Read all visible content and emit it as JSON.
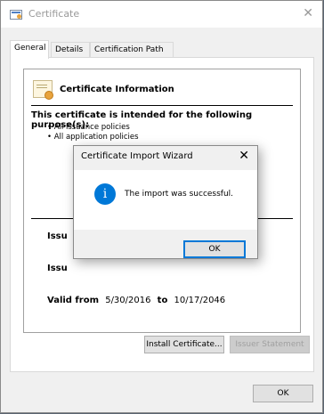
{
  "window": {
    "title": "Certificate",
    "close_glyph": "✕",
    "icon": "certificate-icon"
  },
  "tabs": [
    {
      "label": "General",
      "active": true
    },
    {
      "label": "Details",
      "active": false
    },
    {
      "label": "Certification Path",
      "active": false
    }
  ],
  "info": {
    "icon": "certificate-icon",
    "title": "Certificate Information",
    "purpose_heading": "This certificate is intended for the following purpose(s):",
    "purposes": [
      "• All issuance policies",
      "• All application policies"
    ],
    "issued_to_label_partial": "Issu",
    "issued_by_label_partial": "Issu",
    "valid_from_label": "Valid from",
    "valid_from": "5/30/2016",
    "to_label": "to",
    "valid_to": "10/17/2046"
  },
  "buttons": {
    "install": "Install Certificate...",
    "issuer_statement": "Issuer Statement",
    "ok": "OK"
  },
  "dialog": {
    "title": "Certificate Import Wizard",
    "close_glyph": "✕",
    "icon": "info-icon",
    "icon_glyph": "i",
    "message": "The import was successful.",
    "ok": "OK"
  },
  "colors": {
    "accent": "#0078d7",
    "window_bg": "#f0f0f0",
    "backdrop": "#5a6470"
  }
}
